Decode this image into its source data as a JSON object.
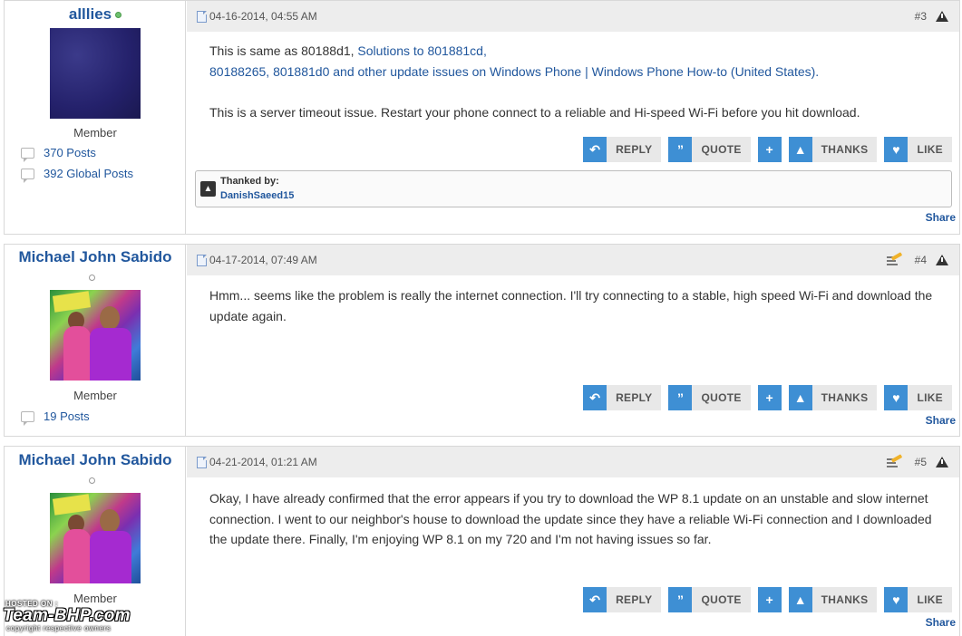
{
  "posts": [
    {
      "username": "alllies",
      "online": true,
      "role": "Member",
      "posts_count": "370 Posts",
      "global_posts": "392 Global Posts",
      "date": "04-16-2014, 04:55 AM",
      "number": "#3",
      "text_part1": "This is same as 80188d1, ",
      "link1": "Solutions to 801881cd,",
      "link2": "80188265, 801881d0 and other update issues on Windows Phone | Windows Phone How-to (United States).",
      "paragraph2": "This is a server timeout issue. Restart your phone connect to a reliable and Hi-speed Wi-Fi before you hit download.",
      "thanked_label": "Thanked by:",
      "thanked_user": "DanishSaeed15",
      "share": "Share"
    },
    {
      "username": "Michael John Sabido",
      "online": false,
      "role": "Member",
      "posts_count": "19 Posts",
      "date": "04-17-2014, 07:49 AM",
      "number": "#4",
      "paragraph1": "Hmm... seems like the problem is really the internet connection. I'll try connecting to a stable, high speed Wi-Fi and download the update again.",
      "share": "Share"
    },
    {
      "username": "Michael John Sabido",
      "online": false,
      "role": "Member",
      "date": "04-21-2014, 01:21 AM",
      "number": "#5",
      "paragraph1": "Okay, I have already confirmed that the error appears if you try to download the WP 8.1 update on an unstable and slow internet connection. I went to our neighbor's house to download the update since they have a reliable Wi-Fi connection and I downloaded the update there. Finally, I'm enjoying WP 8.1 on my 720 and I'm not having issues so far.",
      "share": "Share"
    }
  ],
  "actions": {
    "reply": "REPLY",
    "quote": "QUOTE",
    "thanks": "THANKS",
    "like": "LIKE"
  },
  "icons": {
    "reply": "reply-arrow-icon",
    "quote": "quote-bubble-icon",
    "multiquote": "multiquote-plus-icon",
    "thanks": "thumbs-up-icon",
    "like": "heart-icon"
  },
  "colors": {
    "accent": "#3e8fd4",
    "link": "#21579d",
    "header_bg": "#ededed"
  },
  "watermark": {
    "line1": "HOSTED ON :",
    "line2": "Team-BHP.com",
    "line3": "copyright respective owners"
  }
}
